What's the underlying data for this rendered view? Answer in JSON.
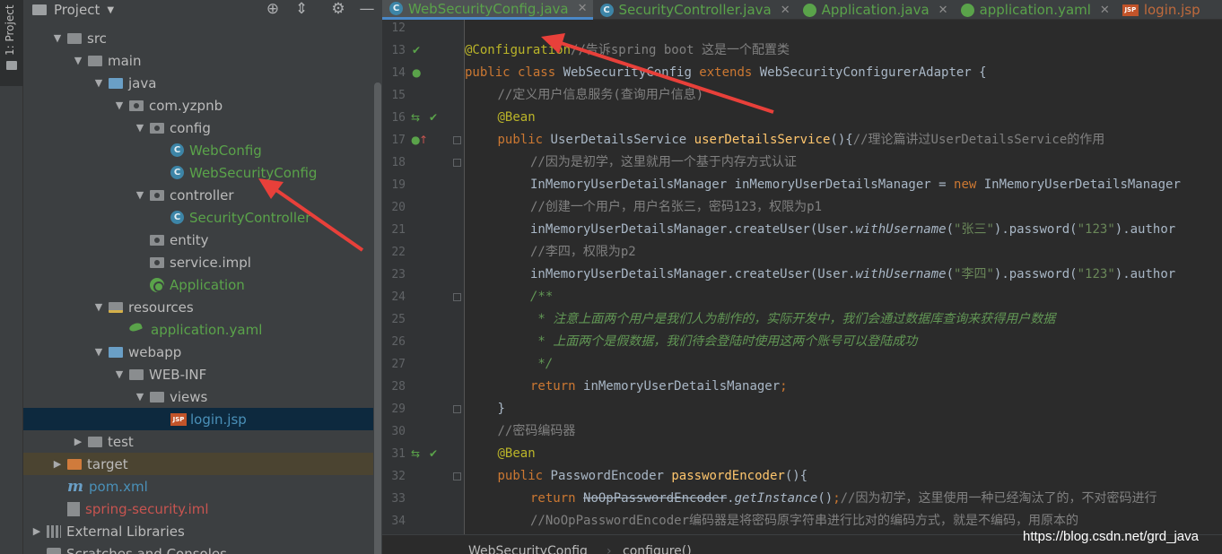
{
  "toolstrip": {
    "project_tab": "1: Project"
  },
  "project_panel": {
    "title": "Project",
    "tree": [
      {
        "label": "src",
        "type": "folder",
        "depth": 1,
        "expanded": true
      },
      {
        "label": "main",
        "type": "folder",
        "depth": 2,
        "expanded": true
      },
      {
        "label": "java",
        "type": "source-folder",
        "depth": 3,
        "expanded": true
      },
      {
        "label": "com.yzpnb",
        "type": "package",
        "depth": 4,
        "expanded": true
      },
      {
        "label": "config",
        "type": "package",
        "depth": 5,
        "expanded": true
      },
      {
        "label": "WebConfig",
        "type": "class",
        "depth": 6
      },
      {
        "label": "WebSecurityConfig",
        "type": "class",
        "depth": 6
      },
      {
        "label": "controller",
        "type": "package",
        "depth": 5,
        "expanded": true
      },
      {
        "label": "SecurityController",
        "type": "class",
        "depth": 6
      },
      {
        "label": "entity",
        "type": "package",
        "depth": 5
      },
      {
        "label": "service.impl",
        "type": "package",
        "depth": 5
      },
      {
        "label": "Application",
        "type": "spring-class",
        "depth": 5
      },
      {
        "label": "resources",
        "type": "resources-folder",
        "depth": 3,
        "expanded": true
      },
      {
        "label": "application.yaml",
        "type": "yaml",
        "depth": 4
      },
      {
        "label": "webapp",
        "type": "web-folder",
        "depth": 3,
        "expanded": true
      },
      {
        "label": "WEB-INF",
        "type": "folder",
        "depth": 4,
        "expanded": true
      },
      {
        "label": "views",
        "type": "folder",
        "depth": 5,
        "expanded": true
      },
      {
        "label": "login.jsp",
        "type": "jsp",
        "depth": 6,
        "selected": true
      },
      {
        "label": "test",
        "type": "folder",
        "depth": 2,
        "expanded": false
      },
      {
        "label": "target",
        "type": "excluded-folder",
        "depth": 1,
        "expanded": false
      },
      {
        "label": "pom.xml",
        "type": "maven",
        "depth": 1
      },
      {
        "label": "spring-security.iml",
        "type": "iml",
        "depth": 1
      },
      {
        "label": "External Libraries",
        "type": "libraries",
        "depth": 0,
        "expanded": false
      },
      {
        "label": "Scratches and Consoles",
        "type": "scratches",
        "depth": 0
      }
    ]
  },
  "editor": {
    "tabs": [
      {
        "label": "WebSecurityConfig.java",
        "icon": "class",
        "active": true
      },
      {
        "label": "SecurityController.java",
        "icon": "class"
      },
      {
        "label": "Application.java",
        "icon": "spring-class"
      },
      {
        "label": "application.yaml",
        "icon": "yaml"
      },
      {
        "label": "login.jsp",
        "icon": "jsp"
      }
    ],
    "first_line": 12,
    "line_numbers": [
      "12",
      "13",
      "14",
      "15",
      "16",
      "17",
      "18",
      "19",
      "20",
      "21",
      "22",
      "23",
      "24",
      "25",
      "26",
      "27",
      "28",
      "29",
      "30",
      "31",
      "32",
      "33",
      "34"
    ],
    "code_lines": [
      {
        "n": 12,
        "indent": 0,
        "tokens": []
      },
      {
        "n": 13,
        "indent": 0,
        "tokens": [
          [
            "ann",
            "@Configuration"
          ],
          [
            "cm",
            "//告诉spring boot 这是一个配置类"
          ]
        ]
      },
      {
        "n": 14,
        "indent": 0,
        "tokens": [
          [
            "kw",
            "public class "
          ],
          [
            "plain",
            "WebSecurityConfig "
          ],
          [
            "kw",
            "extends "
          ],
          [
            "plain",
            "WebSecurityConfigurerAdapter {"
          ]
        ]
      },
      {
        "n": 15,
        "indent": 1,
        "tokens": [
          [
            "cm",
            "//定义用户信息服务(查询用户信息)"
          ]
        ]
      },
      {
        "n": 16,
        "indent": 1,
        "tokens": [
          [
            "ann",
            "@Bean"
          ]
        ]
      },
      {
        "n": 17,
        "indent": 1,
        "tokens": [
          [
            "kw",
            "public "
          ],
          [
            "plain",
            "UserDetailsService "
          ],
          [
            "fn",
            "userDetailsService"
          ],
          [
            "plain",
            "(){"
          ],
          [
            "cm",
            "//理论篇讲过UserDetailsService的作用"
          ]
        ]
      },
      {
        "n": 18,
        "indent": 2,
        "tokens": [
          [
            "cm",
            "//因为是初学，这里就用一个基于内存方式认证"
          ]
        ]
      },
      {
        "n": 19,
        "indent": 2,
        "tokens": [
          [
            "plain",
            "InMemoryUserDetailsManager inMemoryUserDetailsManager = "
          ],
          [
            "kw",
            "new "
          ],
          [
            "plain",
            "InMemoryUserDetailsManager"
          ]
        ]
      },
      {
        "n": 20,
        "indent": 2,
        "tokens": [
          [
            "cm",
            "//创建一个用户，用户名张三，密码123，权限为p1"
          ]
        ]
      },
      {
        "n": 21,
        "indent": 2,
        "tokens": [
          [
            "plain",
            "inMemoryUserDetailsManager.createUser(User."
          ],
          [
            "ital",
            "withUsername"
          ],
          [
            "plain",
            "("
          ],
          [
            "str",
            "\"张三\""
          ],
          [
            "plain",
            ").password("
          ],
          [
            "str",
            "\"123\""
          ],
          [
            "plain",
            ").author"
          ]
        ]
      },
      {
        "n": 22,
        "indent": 2,
        "tokens": [
          [
            "cm",
            "//李四，权限为p2"
          ]
        ]
      },
      {
        "n": 23,
        "indent": 2,
        "tokens": [
          [
            "plain",
            "inMemoryUserDetailsManager.createUser(User."
          ],
          [
            "ital",
            "withUsername"
          ],
          [
            "plain",
            "("
          ],
          [
            "str",
            "\"李四\""
          ],
          [
            "plain",
            ").password("
          ],
          [
            "str",
            "\"123\""
          ],
          [
            "plain",
            ").author"
          ]
        ]
      },
      {
        "n": 24,
        "indent": 2,
        "tokens": [
          [
            "doc",
            "/**"
          ]
        ]
      },
      {
        "n": 25,
        "indent": 2,
        "tokens": [
          [
            "doc",
            " * 注意上面两个用户是我们人为制作的，实际开发中，我们会通过数据库查询来获得用户数据"
          ]
        ]
      },
      {
        "n": 26,
        "indent": 2,
        "tokens": [
          [
            "doc",
            " * 上面两个是假数据，我们待会登陆时使用这两个账号可以登陆成功"
          ]
        ]
      },
      {
        "n": 27,
        "indent": 2,
        "tokens": [
          [
            "doc",
            " */"
          ]
        ]
      },
      {
        "n": 28,
        "indent": 2,
        "tokens": [
          [
            "kw",
            "return "
          ],
          [
            "plain",
            "inMemoryUserDetailsManager"
          ],
          [
            "kw",
            ";"
          ]
        ]
      },
      {
        "n": 29,
        "indent": 1,
        "tokens": [
          [
            "plain",
            "}"
          ]
        ]
      },
      {
        "n": 30,
        "indent": 1,
        "tokens": [
          [
            "cm",
            "//密码编码器"
          ]
        ]
      },
      {
        "n": 31,
        "indent": 1,
        "tokens": [
          [
            "ann",
            "@Bean"
          ]
        ]
      },
      {
        "n": 32,
        "indent": 1,
        "tokens": [
          [
            "kw",
            "public "
          ],
          [
            "plain",
            "PasswordEncoder "
          ],
          [
            "fn",
            "passwordEncoder"
          ],
          [
            "plain",
            "(){"
          ]
        ]
      },
      {
        "n": 33,
        "indent": 2,
        "tokens": [
          [
            "kw",
            "return "
          ],
          [
            "strike",
            "NoOpPasswordEncoder"
          ],
          [
            "plain",
            "."
          ],
          [
            "ital",
            "getInstance"
          ],
          [
            "plain",
            "()"
          ],
          [
            "kw",
            ";"
          ],
          [
            "cm",
            "//因为初学，这里使用一种已经淘汰了的，不对密码进行"
          ]
        ]
      },
      {
        "n": 34,
        "indent": 2,
        "tokens": [
          [
            "cm",
            "//NoOpPasswordEncoder编码器是将密码原字符串进行比对的编码方式，就是不编码，用原本的"
          ]
        ]
      }
    ],
    "breadcrumb": {
      "class_name": "WebSecurityConfig",
      "separator": "›",
      "method": "configure()"
    }
  },
  "watermark": "https://blog.csdn.net/grd_java",
  "colors": {
    "annotation_arrow": "#e8403a",
    "selection": "#0d293e",
    "excluded": "#4b4431",
    "tab_active_underline": "#4a88c7"
  }
}
